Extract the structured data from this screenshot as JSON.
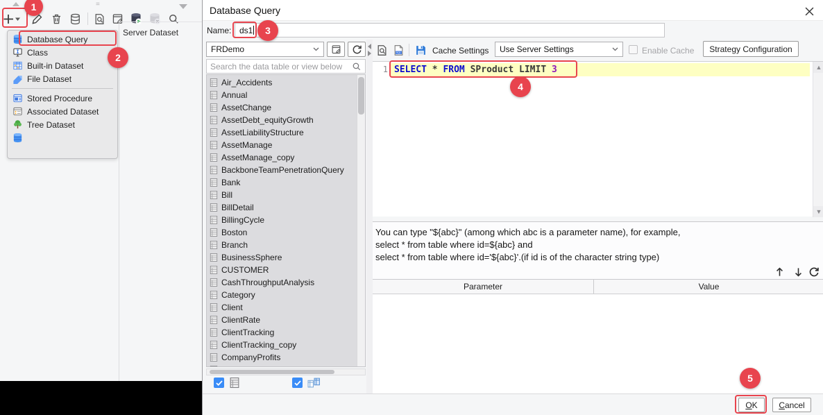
{
  "app": {
    "toolbar": {
      "icons": [
        "add-dataset-icon",
        "edit-icon",
        "delete-icon",
        "database-copy-icon",
        "preview-icon",
        "connection-edit-icon",
        "database-run-icon",
        "database-stop-icon",
        "search-icon"
      ]
    },
    "server_dataset_label": "Server Dataset",
    "menu": {
      "items": [
        {
          "icon": "database-icon",
          "label": "Database Query"
        },
        {
          "icon": "class-monitor-icon",
          "label": "Class"
        },
        {
          "icon": "builtin-dataset-icon",
          "label": "Built-in Dataset"
        },
        {
          "icon": "file-dataset-icon",
          "label": "File Dataset"
        },
        {
          "icon": "stored-procedure-icon",
          "label": "Stored Procedure"
        },
        {
          "icon": "associated-dataset-icon",
          "label": "Associated Dataset"
        },
        {
          "icon": "tree-dataset-icon",
          "label": "Tree Dataset"
        },
        {
          "icon": "database-icon",
          "label": ""
        }
      ]
    }
  },
  "dialog": {
    "title": "Database Query",
    "name": {
      "label": "Name:",
      "value": "ds1"
    },
    "connection": {
      "selected": "FRDemo"
    },
    "search_placeholder": "Search the data table or view below",
    "tables": [
      "Air_Accidents",
      "Annual",
      "AssetChange",
      "AssetDebt_equityGrowth",
      "AssetLiabilityStructure",
      "AssetManage",
      "AssetManage_copy",
      "BackboneTeamPenetrationQuery",
      "Bank",
      "Bill",
      "BillDetail",
      "BillingCycle",
      "Boston",
      "Branch",
      "BusinessSphere",
      "CUSTOMER",
      "CashThroughputAnalysis",
      "Category",
      "Client",
      "ClientRate",
      "ClientTracking",
      "ClientTracking_copy",
      "CompanyProfits"
    ],
    "filters": {
      "tables_checked": true,
      "views_checked": true
    },
    "sql_toolbar": {
      "cache_settings_label": "Cache Settings",
      "cache_mode_value": "Use Server Settings",
      "enable_cache_label": "Enable Cache",
      "strategy_button_label": "Strategy Configuration"
    },
    "sql": {
      "line_number": "1",
      "full_text": "SELECT * FROM SProduct LIMIT 3",
      "tokens": [
        {
          "text": "SELECT",
          "type": "keyword"
        },
        {
          "text": " * ",
          "type": "plain"
        },
        {
          "text": "FROM",
          "type": "keyword"
        },
        {
          "text": " SProduct LIMIT ",
          "type": "plain"
        },
        {
          "text": "3",
          "type": "number"
        }
      ]
    },
    "hint_lines": [
      "You can type \"${abc}\" (among which abc is a parameter name), for example,",
      "select * from table where id=${abc} and",
      "select * from table where id='${abc}'.(if id is of the character string type)"
    ],
    "param_table": {
      "columns": [
        "Parameter",
        "Value"
      ]
    },
    "footer": {
      "ok_accel": "O",
      "ok_rest": "K",
      "cancel_accel": "C",
      "cancel_rest": "ancel"
    }
  },
  "annotations": {
    "badges": [
      "1",
      "2",
      "3",
      "4",
      "5"
    ]
  },
  "colors": {
    "annotation_red": "#e8444e",
    "checkbox_blue": "#3a8cf7",
    "sql_keyword_blue": "#0d0dcf",
    "sql_number_purple": "#8d18b8",
    "sql_line_yellow": "#feffc2"
  }
}
